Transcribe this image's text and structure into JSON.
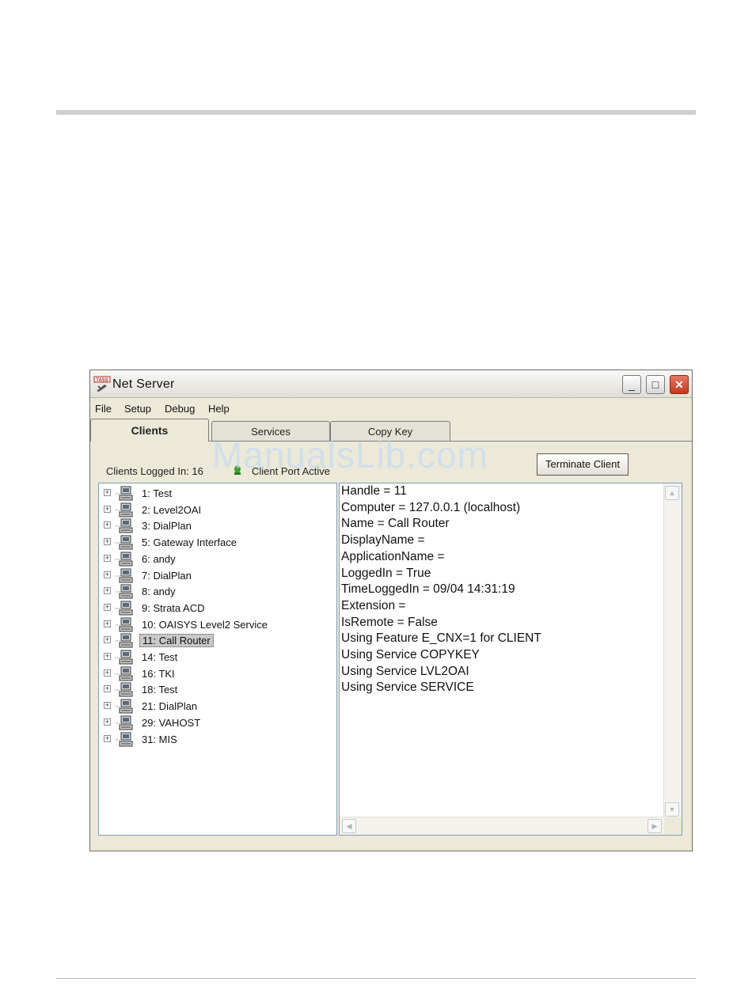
{
  "window": {
    "title": "Net Server",
    "icon_text": "TASS",
    "minimize": "_",
    "maximize": "□",
    "close": "✕"
  },
  "menu": [
    "File",
    "Setup",
    "Debug",
    "Help"
  ],
  "tabs": [
    {
      "label": "Clients",
      "active": true
    },
    {
      "label": "Services",
      "active": false
    },
    {
      "label": "Copy Key",
      "active": false
    }
  ],
  "clients_panel": {
    "logged_in_label": "Clients Logged In: 16",
    "status_text": "Client Port Active",
    "terminate_button": "Terminate Client",
    "clients": [
      "1: Test",
      "2: Level2OAI",
      "3: DialPlan",
      "5: Gateway Interface",
      "6: andy",
      "7: DialPlan",
      "8: andy",
      "9: Strata ACD",
      "10: OAISYS Level2 Service",
      "11: Call Router",
      "14: Test",
      "16: TKI",
      "18: Test",
      "21: DialPlan",
      "29: VAHOST",
      "31: MIS"
    ],
    "selected_client": "11: Call Router",
    "details": [
      "Handle = 11",
      "Computer = 127.0.0.1 (localhost)",
      "Name = Call Router",
      "DisplayName =",
      "ApplicationName =",
      "LoggedIn = True",
      "TimeLoggedIn = 09/04 14:31:19",
      "Extension =",
      "IsRemote = False",
      "Using Feature E_CNX=1 for CLIENT",
      "Using Service COPYKEY",
      "Using Service LVL2OAI",
      "Using Service SERVICE"
    ]
  },
  "watermark": "ManualsLib.com",
  "colors": {
    "window_bg": "#ece9d8",
    "close_button": "#c4391f",
    "selection": "#c8c8c8",
    "status_green": "#3aa62e"
  }
}
